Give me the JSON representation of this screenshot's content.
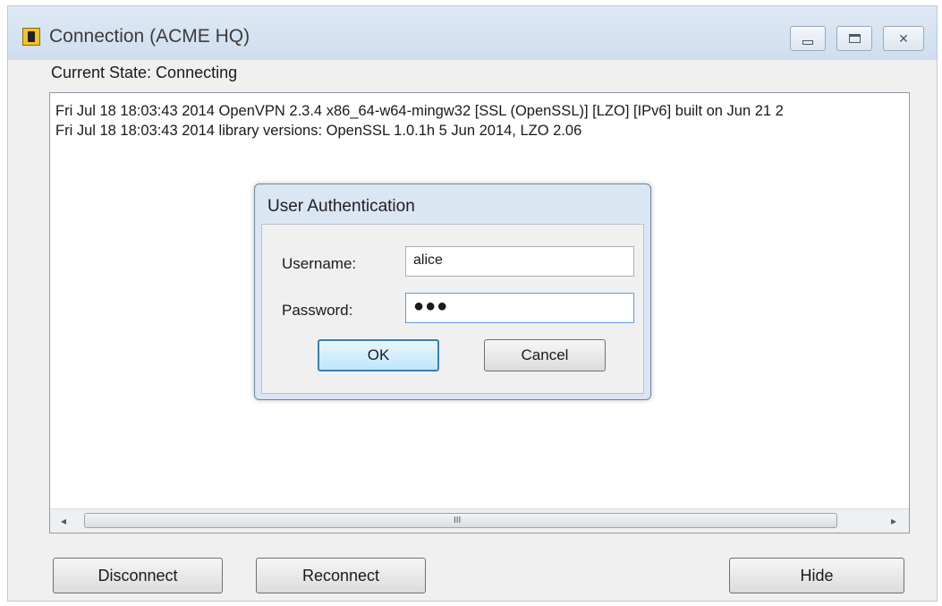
{
  "window": {
    "title": "Connection (ACME HQ)",
    "icon": "openvpn-icon",
    "controls": {
      "minimize": "minimize",
      "maximize": "maximize",
      "close": "✕"
    }
  },
  "status": {
    "text": "Current State: Connecting"
  },
  "log": {
    "lines": [
      "Fri Jul 18 18:03:43 2014 OpenVPN 2.3.4 x86_64-w64-mingw32 [SSL (OpenSSL)] [LZO] [IPv6] built on Jun 21 2",
      "Fri Jul 18 18:03:43 2014 library versions: OpenSSL 1.0.1h 5 Jun 2014, LZO 2.06"
    ],
    "scroll_left": "◂",
    "scroll_right": "▸",
    "scroll_grip": "III"
  },
  "buttons": {
    "disconnect": "Disconnect",
    "reconnect": "Reconnect",
    "hide": "Hide"
  },
  "auth_dialog": {
    "title": "User Authentication",
    "username_label": "Username:",
    "username_value": "alice",
    "password_label": "Password:",
    "password_value": "●●●",
    "ok": "OK",
    "cancel": "Cancel"
  }
}
